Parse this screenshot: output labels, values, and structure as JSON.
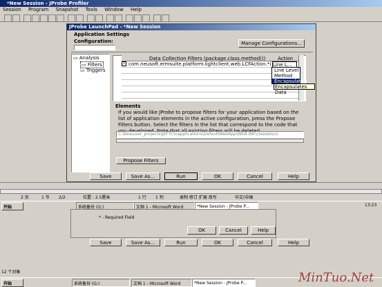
{
  "app": {
    "title": "*New Session - JProbe Profiler"
  },
  "menu": [
    "Session",
    "Program",
    "Snapshot",
    "Tools",
    "Window",
    "Help"
  ],
  "dialog": {
    "title": "JProbe LaunchPad - *New Session",
    "section_app": "Application Settings",
    "config_label": "Configuration:",
    "manage_button": "Manage Configurations..."
  },
  "tree": {
    "root": "Analysis",
    "items": [
      "Filters",
      "Triggers"
    ]
  },
  "filters": {
    "col1": "Data Collection Filters (package.class.method())",
    "col2": "Action",
    "row1": "com.neusoft.ermsuite.platform.lightclient.web.LCFAction.*()",
    "row1_action": "Line L...",
    "dropdown": [
      "Line Level",
      "Method Level",
      "Encapsulated"
    ],
    "tooltip": "Encapsulates Data"
  },
  "elements": {
    "title": "Elements",
    "desc": "If you would like JProbe to propose filters for your application based on the list of application elements in the active configuration, press the Propose Filters button.  Select the filters in the list that correspond to the code that you developed.  Note that all existing filters will be deleted.",
    "path": "C:\\bea\\user_projects\\JEFTCS\\applications\\DefaultWebApp\\WEB-INF\\classes\\co",
    "propose": "Propose Filters"
  },
  "buttons": {
    "save": "Save",
    "saveas": "Save As...",
    "run": "Run",
    "ok": "OK",
    "cancel": "Cancel",
    "help": "Help"
  },
  "status1": {
    "a": "2 页",
    "b": "1 节",
    "c": "2/2",
    "d": "位置 : 2.5厘米",
    "e": "1 行",
    "f": "1 列",
    "g": "录制 修订 扩展 改写",
    "h": "中文(中国"
  },
  "taskbar": {
    "start": "开始",
    "items": [
      "系统备份 (G:)",
      "文档 1 - Microsoft Word",
      "*New Session - JProbe P..."
    ],
    "clock": "13:23"
  },
  "lower": {
    "required": "* - Required Field",
    "status": "12 个对象"
  },
  "watermark": "MinTuo.Net"
}
